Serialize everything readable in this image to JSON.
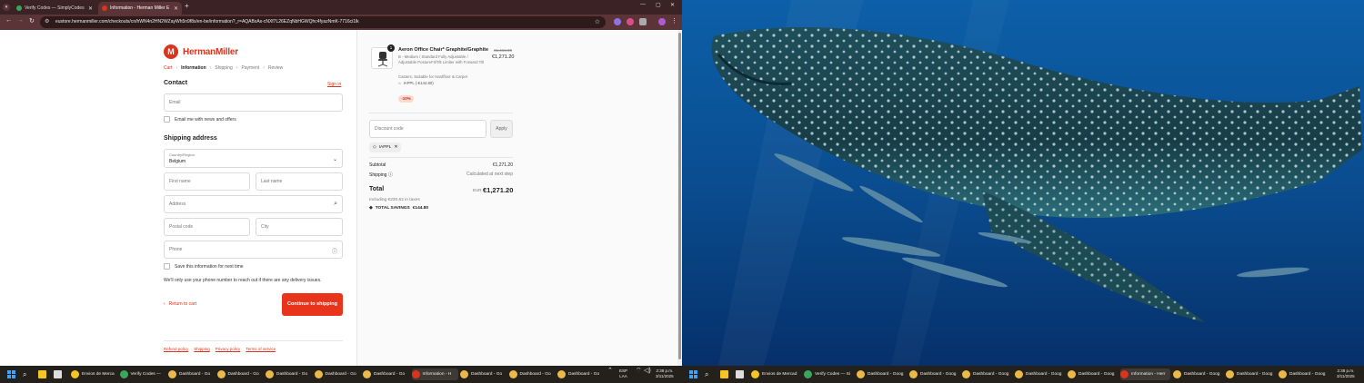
{
  "browser": {
    "tabs": [
      {
        "title": "Verify Codes — SimplyCodes",
        "color": "#3aa65a"
      },
      {
        "title": "Information - Herman Miller E",
        "color": "#d9341d"
      }
    ],
    "url": "eustore.hermanmiller.com/checkouts/cn/hWN4n2HN2WZayWh5n9f8s/en-be/information?_r=AQABxAs-cNXf7L26EZqNbHGWQhc4fyazNmK-7716ci1lk"
  },
  "checkout": {
    "brand": "HermanMiller",
    "breadcrumb": [
      "Cart",
      "Information",
      "Shipping",
      "Payment",
      "Review"
    ],
    "contact_heading": "Contact",
    "sign_in": "Sign in",
    "email_placeholder": "Email",
    "newsletter_label": "Email me with news and offers",
    "shipping_heading": "Shipping address",
    "country_label": "Country/Region",
    "country_value": "Belgium",
    "first_name": "First name",
    "last_name": "Last name",
    "address": "Address",
    "postal_code": "Postal code",
    "city": "City",
    "phone": "Phone",
    "save_info": "Save this information for next time",
    "phone_note": "We'll only use your phone number to reach out if there are any delivery issues.",
    "return_to_cart": "Return to cart",
    "continue_button": "Continue to shipping",
    "footer_links": [
      "Refund policy",
      "Shipping",
      "Privacy policy",
      "Terms of service"
    ]
  },
  "summary": {
    "quantity": "1",
    "product_name": "Aeron Office Chair* Graphite/Graphite",
    "product_desc": "B - Medium / Standard Fully Adjustable / Adjustable PostureFit/Tilt Limiter with Forward Tilt",
    "product_casters": "Casters, Suitable for Hardfloor & Carpet",
    "product_code": "IAPPL (-€144.80)",
    "old_price": "€1,416.00",
    "new_price": "€1,271.20",
    "discount_pct": "-10%",
    "discount_placeholder": "Discount code",
    "apply": "Apply",
    "applied_code": "IAPPL",
    "subtotal_label": "Subtotal",
    "subtotal_value": "€1,271.20",
    "shipping_label": "Shipping",
    "shipping_value": "Calculated at next step",
    "total_label": "Total",
    "total_currency": "EUR",
    "total_value": "€1,271.20",
    "tax_note": "Including €220.62 in taxes",
    "savings_label": "TOTAL SAVINGS",
    "savings_value": "€144.80"
  },
  "taskbar_left": {
    "items": [
      {
        "label": "Envios de Merca",
        "color": "#f3c623"
      },
      {
        "label": "Verify Codes —",
        "color": "#3aa65a"
      },
      {
        "label": "Dashboard - Go",
        "color": "#e9b949"
      },
      {
        "label": "Dashboard - Go",
        "color": "#e9b949"
      },
      {
        "label": "Dashboard - Go",
        "color": "#e9b949"
      },
      {
        "label": "Dashboard - Go",
        "color": "#e9b949"
      },
      {
        "label": "Dashboard - Go",
        "color": "#e9b949"
      },
      {
        "label": "Information - H",
        "color": "#d9341d"
      },
      {
        "label": "Dashboard - Go",
        "color": "#e9b949"
      },
      {
        "label": "Dashboard - Go",
        "color": "#e9b949"
      },
      {
        "label": "Dashboard - Go",
        "color": "#e9b949"
      }
    ],
    "lang": "ESP",
    "lang2": "LAA",
    "time": "2:38 p.m.",
    "date": "3/11/2025"
  },
  "taskbar_right": {
    "items": [
      {
        "label": "Envios de Mercad",
        "color": "#f3c623"
      },
      {
        "label": "Verify Codes — Si",
        "color": "#3aa65a"
      },
      {
        "label": "Dashboard - Goog",
        "color": "#e9b949"
      },
      {
        "label": "Dashboard - Goog",
        "color": "#e9b949"
      },
      {
        "label": "Dashboard - Goog",
        "color": "#e9b949"
      },
      {
        "label": "Dashboard - Goog",
        "color": "#e9b949"
      },
      {
        "label": "Dashboard - Goog",
        "color": "#e9b949"
      },
      {
        "label": "Information - Herr",
        "color": "#d9341d"
      },
      {
        "label": "Dashboard - Goog",
        "color": "#e9b949"
      },
      {
        "label": "Dashboard - Goog",
        "color": "#e9b949"
      },
      {
        "label": "Dashboard - Goog",
        "color": "#e9b949"
      }
    ],
    "time": "2:38 p.m.",
    "date": "3/11/2025"
  },
  "colors": {
    "accent": "#e7341a",
    "wallpaper_sea": "#0a4a8a"
  }
}
